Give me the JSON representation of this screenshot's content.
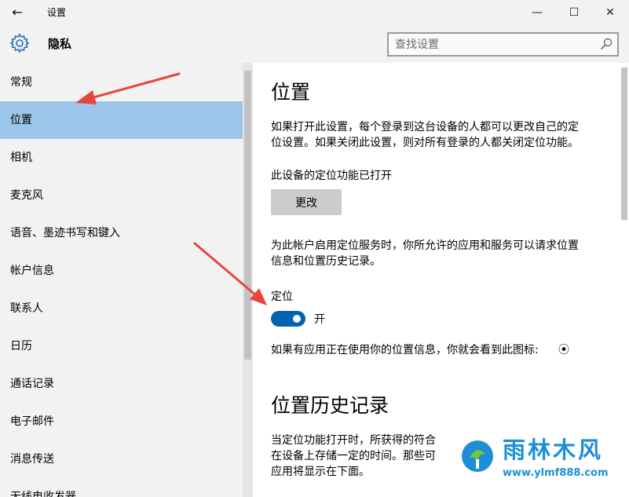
{
  "window": {
    "back_glyph": "←",
    "title": "设置",
    "minimize_glyph": "—",
    "maximize_glyph": "☐",
    "close_glyph": "✕"
  },
  "header": {
    "icon": "gear-icon",
    "title": "隐私",
    "search_placeholder": "查找设置",
    "search_icon": "search-icon"
  },
  "sidebar": {
    "items": [
      {
        "label": "常规"
      },
      {
        "label": "位置",
        "selected": true
      },
      {
        "label": "相机"
      },
      {
        "label": "麦克风"
      },
      {
        "label": "语音、墨迹书写和键入"
      },
      {
        "label": "帐户信息"
      },
      {
        "label": "联系人"
      },
      {
        "label": "日历"
      },
      {
        "label": "通话记录"
      },
      {
        "label": "电子邮件"
      },
      {
        "label": "消息传送"
      },
      {
        "label": "无线电收发器"
      }
    ]
  },
  "main": {
    "heading": "位置",
    "description_line1": "如果打开此设置，每个登录到这台设备的人都可以更改自己的定",
    "description_line2": "位设置。如果关闭此设置，则对所有登录的人都关闭定位功能。",
    "device_status": "此设备的定位功能已打开",
    "change_button": "更改",
    "account_line1": "为此帐户启用定位服务时，你所允许的应用和服务可以请求位置",
    "account_line2": "信息和位置历史记录。",
    "location_label": "定位",
    "toggle_state": "开",
    "toggle_on": true,
    "usage_note": "如果有应用正在使用你的位置信息，你就会看到此图标:",
    "usage_icon_glyph": "⦿",
    "history_heading": "位置历史记录",
    "history_line1": "当定位功能打开时，所获得的符合",
    "history_line2": "在设备上存储一定的时间。那些可",
    "history_line3": "应用将显示在下面。"
  },
  "colors": {
    "selected_bg": "#9cc6ea",
    "toggle_on": "#0063b1",
    "arrow": "#e8453c",
    "watermark": "#1e8fd6"
  },
  "watermark": {
    "title": "雨林木风",
    "url": "www.ylmf888.com"
  }
}
